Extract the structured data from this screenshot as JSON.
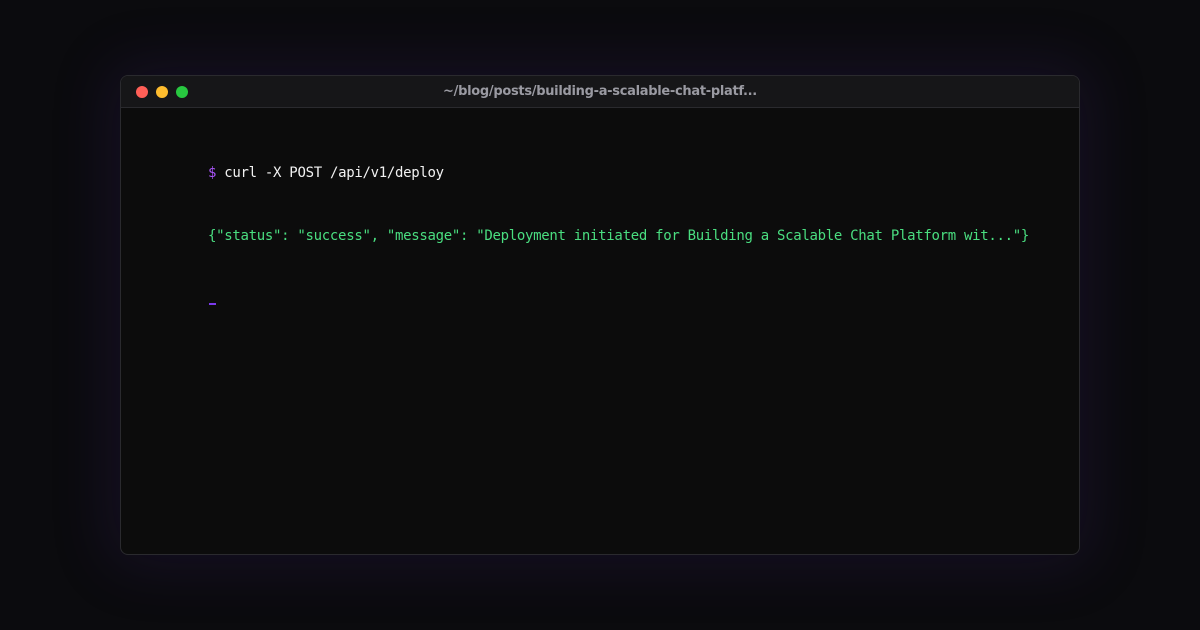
{
  "window": {
    "title": "~/blog/posts/building-a-scalable-chat-platf..."
  },
  "terminal": {
    "prompt_symbol": "$",
    "command": "curl -X POST /api/v1/deploy",
    "response": "{\"status\": \"success\", \"message\": \"Deployment initiated for Building a Scalable Chat Platform wit...\"}"
  },
  "colors": {
    "prompt": "#a855f7",
    "command": "#f2f2f2",
    "response": "#4ade80",
    "cursor": "#7c3aed",
    "close_dot": "#ff5f57",
    "minimize_dot": "#febc2e",
    "maximize_dot": "#28c840"
  }
}
